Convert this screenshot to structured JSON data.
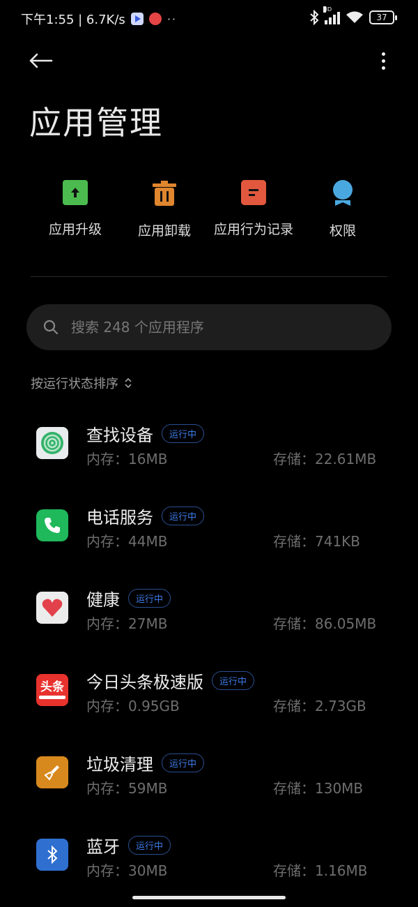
{
  "status_bar": {
    "time_speed": "下午1:55 | 6.7K/s",
    "dots": "··",
    "network_label": "HD",
    "battery": "37"
  },
  "header": {
    "title": "应用管理"
  },
  "quick_actions": [
    {
      "label": "应用升级",
      "icon": "upgrade-icon",
      "color": "#4cbb4f"
    },
    {
      "label": "应用卸载",
      "icon": "trash-icon",
      "color": "#e0862e"
    },
    {
      "label": "应用行为记录",
      "icon": "record-icon",
      "color": "#e2583e"
    },
    {
      "label": "权限",
      "icon": "permission-icon",
      "color": "#4aa8e0"
    }
  ],
  "search": {
    "placeholder": "搜索 248 个应用程序"
  },
  "sort": {
    "label": "按运行状态排序"
  },
  "apps": [
    {
      "name": "查找设备",
      "badge": "运行中",
      "memory": "内存：16MB",
      "storage": "存储：22.61MB",
      "icon": "find-device-icon"
    },
    {
      "name": "电话服务",
      "badge": "运行中",
      "memory": "内存：44MB",
      "storage": "存储：741KB",
      "icon": "phone-icon"
    },
    {
      "name": "健康",
      "badge": "运行中",
      "memory": "内存：27MB",
      "storage": "存储：86.05MB",
      "icon": "heart-icon"
    },
    {
      "name": "今日头条极速版",
      "badge": "运行中",
      "memory": "内存：0.95GB",
      "storage": "存储：2.73GB",
      "icon": "toutiao-icon",
      "icon_text": "头条"
    },
    {
      "name": "垃圾清理",
      "badge": "运行中",
      "memory": "内存：59MB",
      "storage": "存储：130MB",
      "icon": "broom-icon"
    },
    {
      "name": "蓝牙",
      "badge": "运行中",
      "memory": "内存：30MB",
      "storage": "存储：1.16MB",
      "icon": "bluetooth-icon"
    }
  ]
}
